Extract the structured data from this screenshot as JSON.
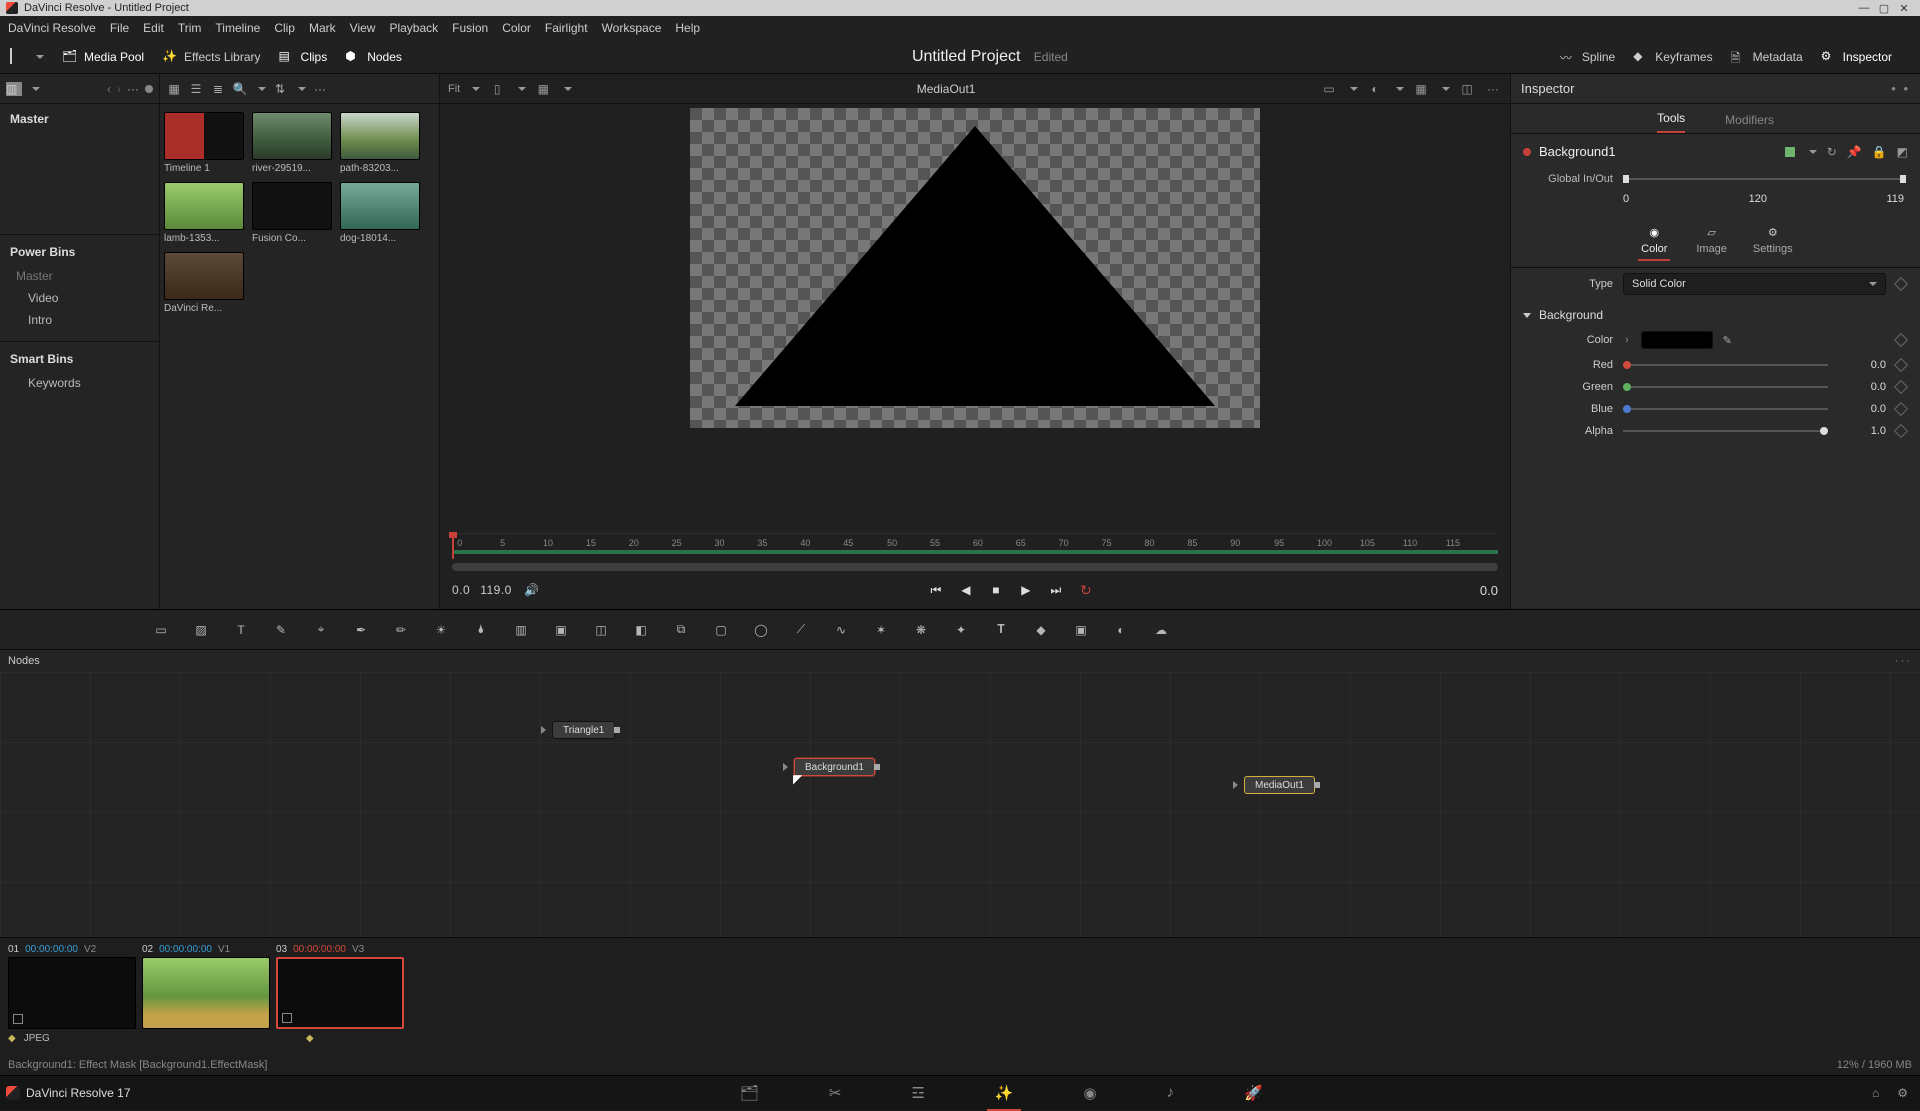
{
  "window": {
    "title": "DaVinci Resolve - Untitled Project"
  },
  "menu": [
    "DaVinci Resolve",
    "File",
    "Edit",
    "Trim",
    "Timeline",
    "Clip",
    "Mark",
    "View",
    "Playback",
    "Fusion",
    "Color",
    "Fairlight",
    "Workspace",
    "Help"
  ],
  "panel_toggles": {
    "media_pool": "Media Pool",
    "effects": "Effects Library",
    "clips": "Clips",
    "nodes": "Nodes",
    "spline": "Spline",
    "keyframes": "Keyframes",
    "metadata": "Metadata",
    "inspector": "Inspector"
  },
  "project": {
    "title": "Untitled Project",
    "state": "Edited"
  },
  "bins": {
    "master": "Master",
    "power": "Power Bins",
    "items": [
      "Master",
      "Video",
      "Intro"
    ],
    "smart": "Smart Bins",
    "keywords": "Keywords"
  },
  "pool_opts": {
    "fit": "Fit"
  },
  "clips": [
    {
      "label": "Timeline 1"
    },
    {
      "label": "river-29519..."
    },
    {
      "label": "path-83203..."
    },
    {
      "label": "lamb-1353..."
    },
    {
      "label": "Fusion Co..."
    },
    {
      "label": "dog-18014..."
    },
    {
      "label": "DaVinci Re..."
    }
  ],
  "viewer": {
    "title": "MediaOut1",
    "time_in": "0.0",
    "time_out": "119.0",
    "time_display": "0.0",
    "ticks": [
      "0",
      "5",
      "10",
      "15",
      "20",
      "25",
      "30",
      "35",
      "40",
      "45",
      "50",
      "55",
      "60",
      "65",
      "70",
      "75",
      "80",
      "85",
      "90",
      "95",
      "100",
      "105",
      "110",
      "115"
    ]
  },
  "inspector": {
    "title": "Inspector",
    "tabs": {
      "tools": "Tools",
      "modifiers": "Modifiers"
    },
    "tool_name": "Background1",
    "io_label": "Global In/Out",
    "io_start": "0",
    "io_mid": "120",
    "io_end": "119",
    "cats": {
      "color": "Color",
      "image": "Image",
      "settings": "Settings"
    },
    "type_label": "Type",
    "type_value": "Solid Color",
    "section": "Background",
    "color_label": "Color",
    "channels": {
      "red": {
        "label": "Red",
        "value": "0.0"
      },
      "green": {
        "label": "Green",
        "value": "0.0"
      },
      "blue": {
        "label": "Blue",
        "value": "0.0"
      },
      "alpha": {
        "label": "Alpha",
        "value": "1.0"
      }
    }
  },
  "nodes_panel": {
    "title": "Nodes",
    "nodes": {
      "triangle": "Triangle1",
      "background": "Background1",
      "mediaout": "MediaOut1"
    }
  },
  "clip_strip": {
    "slots": [
      {
        "idx": "01",
        "tc": "00:00:00:00",
        "trk": "V2"
      },
      {
        "idx": "02",
        "tc": "00:00:00:00",
        "trk": "V1"
      },
      {
        "idx": "03",
        "tc": "00:00:00:00",
        "trk": "V3"
      }
    ],
    "format": "JPEG"
  },
  "status": {
    "left": "Background1: Effect Mask    [Background1.EffectMask]",
    "right": "12% / 1960 MB"
  },
  "footer": {
    "product": "DaVinci Resolve 17"
  }
}
